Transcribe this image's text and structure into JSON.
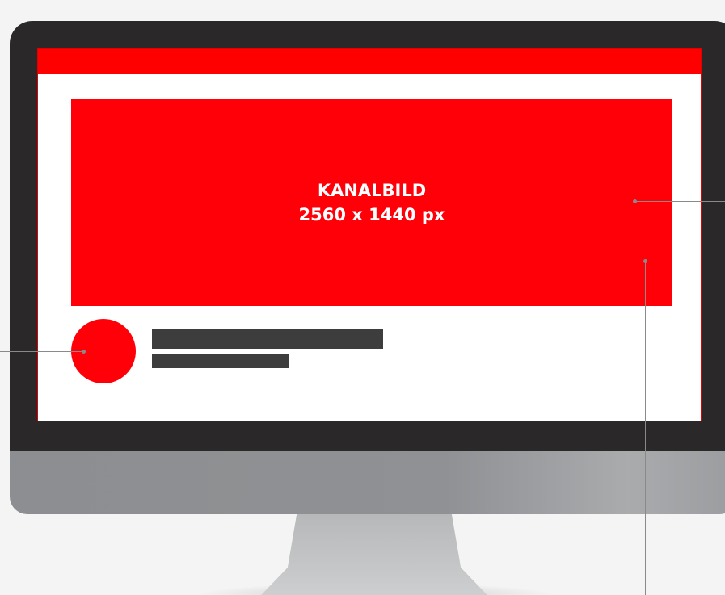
{
  "banner": {
    "line1": "KANALBILD",
    "line2": "2560 x 1440 px"
  },
  "colors": {
    "accent_red": "#ff0009",
    "top_bar_red": "#ff0000",
    "bezel": "#2a2829",
    "placeholder_bar": "#3d3d3d",
    "callout_line": "#8a8a8a"
  }
}
